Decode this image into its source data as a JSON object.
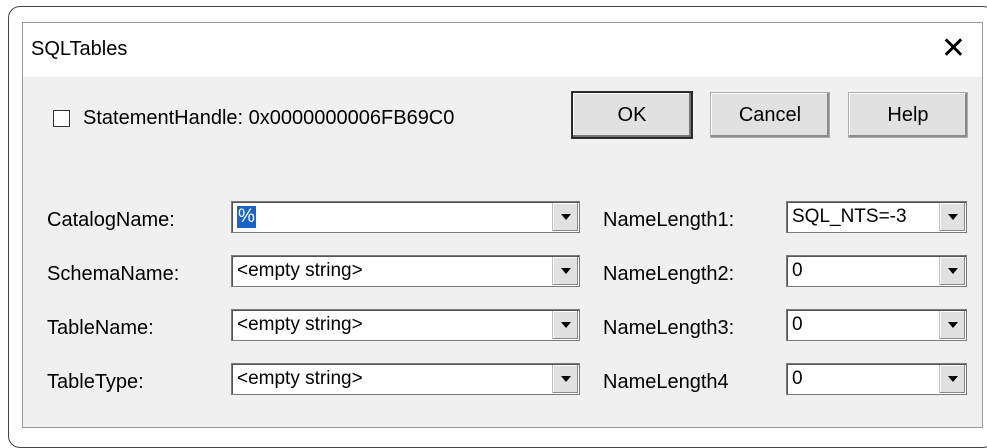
{
  "window": {
    "title": "SQLTables",
    "close_glyph": "✕"
  },
  "statement": {
    "checked": false,
    "label": "StatementHandle: 0x0000000006FB69C0"
  },
  "buttons": {
    "ok": "OK",
    "cancel": "Cancel",
    "help": "Help"
  },
  "fields": [
    {
      "label": "CatalogName:",
      "value": "%",
      "selected": true,
      "length_label": "NameLength1:",
      "length_value": "SQL_NTS=-3"
    },
    {
      "label": "SchemaName:",
      "value": "<empty string>",
      "selected": false,
      "length_label": "NameLength2:",
      "length_value": "0"
    },
    {
      "label": "TableName:",
      "value": "<empty string>",
      "selected": false,
      "length_label": "NameLength3:",
      "length_value": "0"
    },
    {
      "label": "TableType:",
      "value": "<empty string>",
      "selected": false,
      "length_label": "NameLength4",
      "length_value": "0"
    }
  ],
  "icons": {
    "close": "close-icon",
    "dropdown": "chevron-down-icon"
  }
}
